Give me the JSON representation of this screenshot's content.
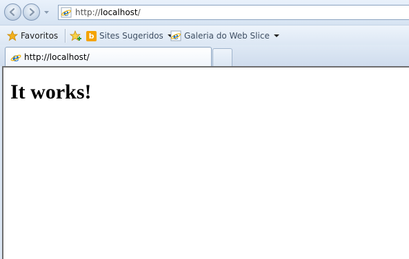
{
  "address_bar": {
    "url_prefix": "http://",
    "url_host": "localhost",
    "url_suffix": "/"
  },
  "favorites_bar": {
    "favorites_label": "Favoritos",
    "items": [
      {
        "label": "Sites Sugeridos",
        "icon": "bing-icon"
      },
      {
        "label": "Galeria do Web Slice",
        "icon": "ie-page-icon"
      }
    ]
  },
  "tabs": [
    {
      "label": "http://localhost/",
      "active": true
    }
  ],
  "page": {
    "heading": "It works!"
  },
  "colors": {
    "chrome": "#dbe6f3",
    "favorites_star": "#f2b01e",
    "bing": "#f4a300",
    "ie_blue": "#1a6fc9"
  }
}
